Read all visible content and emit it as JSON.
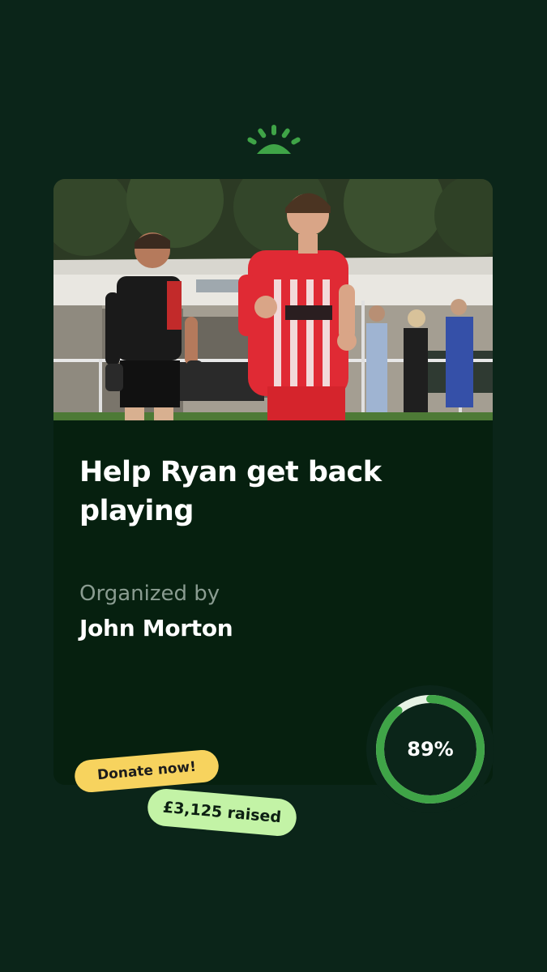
{
  "brand": {
    "logo_icon": "gofundme-sun-icon",
    "accent": "#3fa447"
  },
  "campaign": {
    "image_alt": "Football player in red and white striped kit celebrating on pitch",
    "title": "Help Ryan get back playing",
    "organizer_label": "Organized by",
    "organizer_name": "John Morton"
  },
  "progress": {
    "percent_label": "89%",
    "fraction": 0.89,
    "ring_color": "#3fa447",
    "track_color": "#e6f2e4"
  },
  "cta": {
    "donate_label": "Donate now!",
    "donate_color": "#f7d35e"
  },
  "raised": {
    "label": "£3,125 raised",
    "color": "#c3f3a6"
  }
}
